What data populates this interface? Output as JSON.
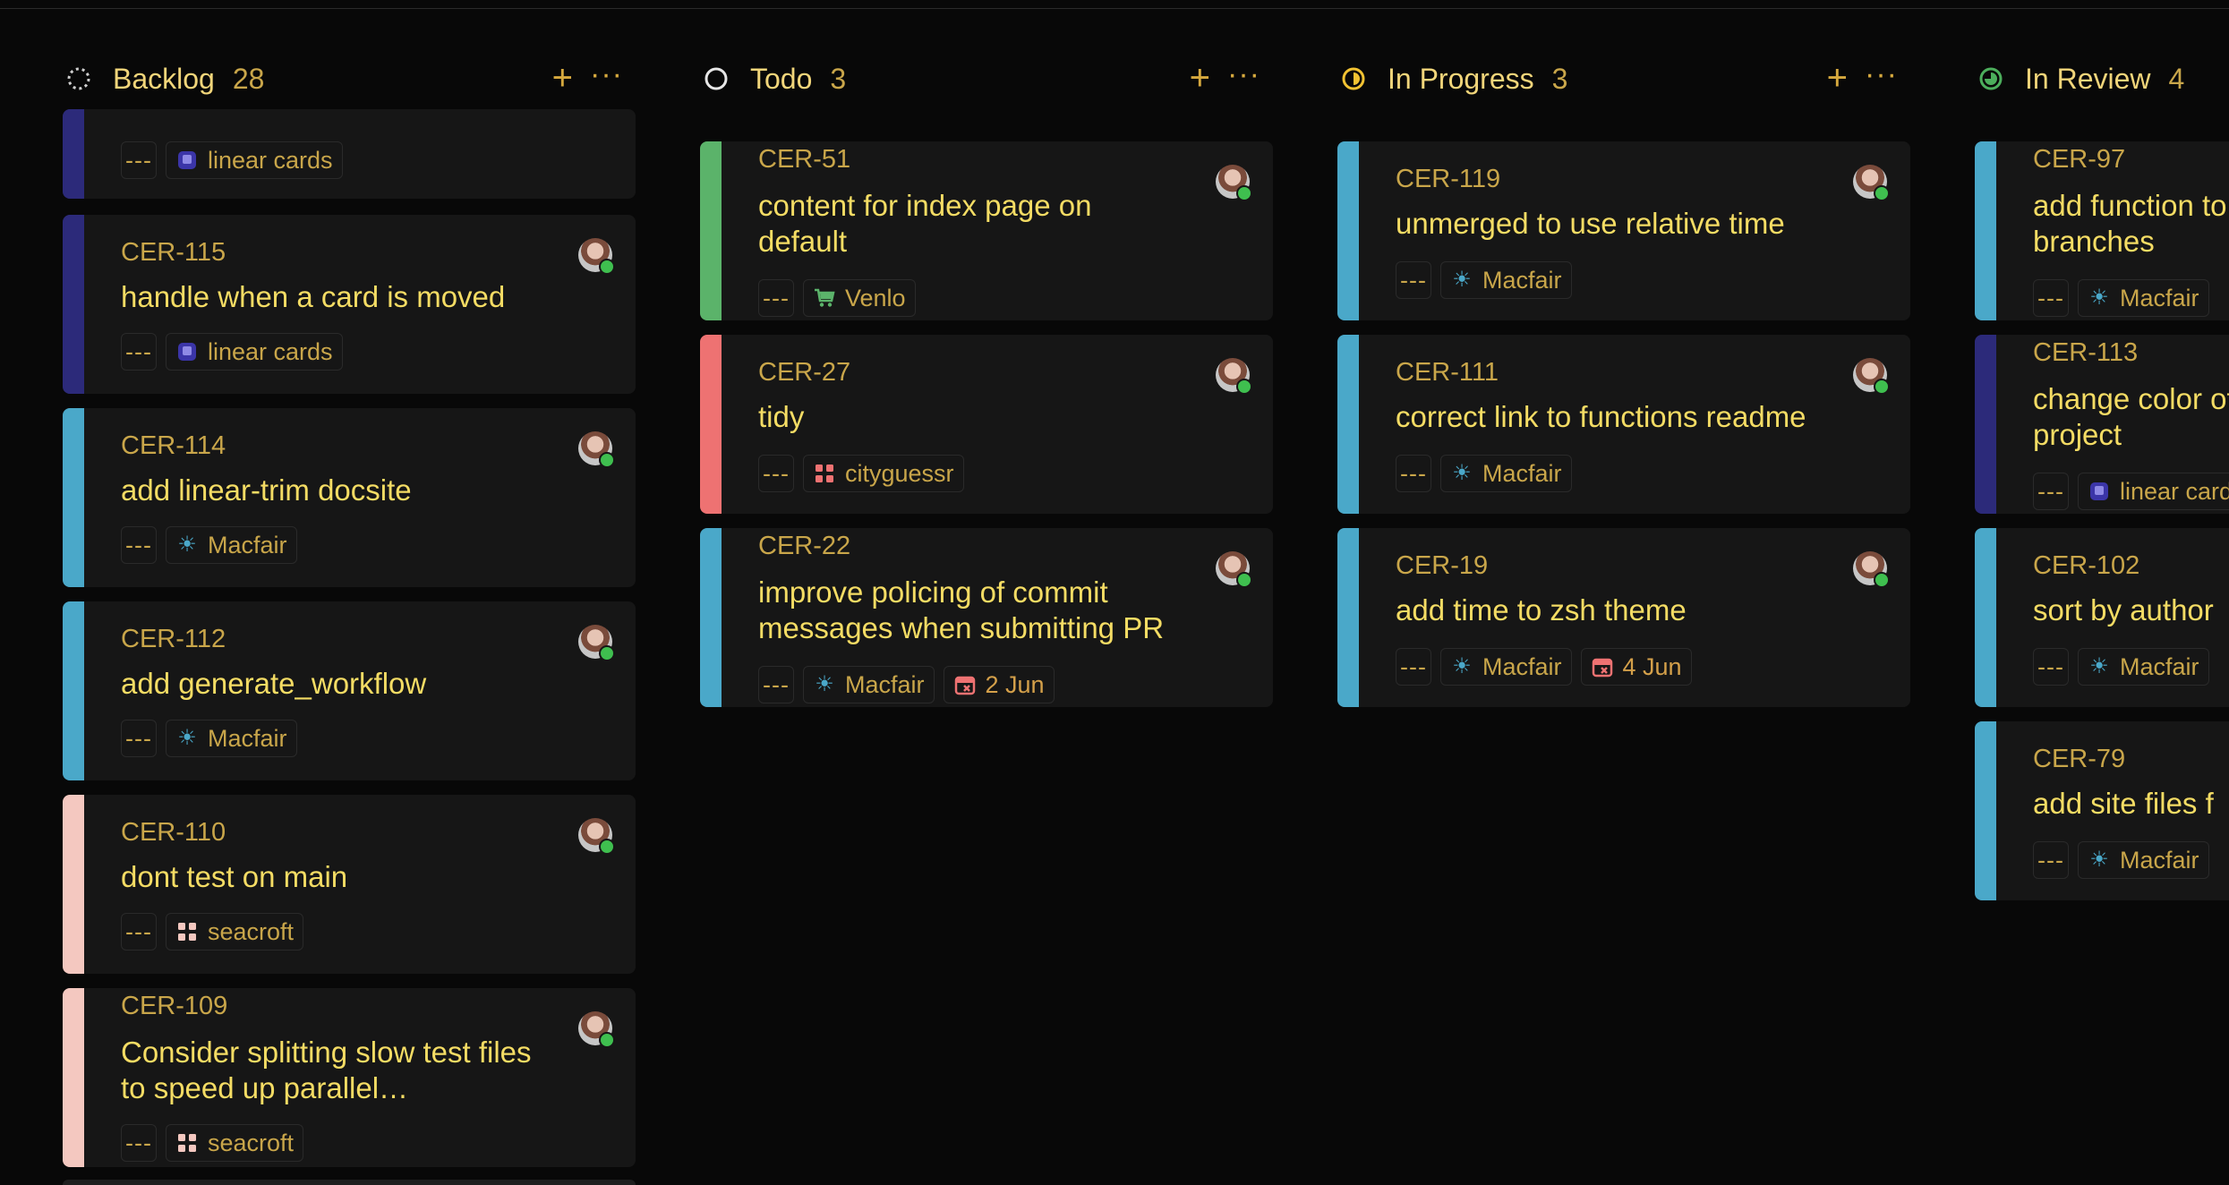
{
  "columns": [
    {
      "title": "Backlog",
      "count": "28",
      "status_icon": "backlog-icon",
      "add_label": "+",
      "more_label": "···",
      "cards": [
        {
          "id": "",
          "title": "",
          "bar_color": "#2c2a7a",
          "project": "linear cards",
          "project_icon": "linear-cards-icon",
          "dots": "---"
        },
        {
          "id": "CER-115",
          "title": "handle when a card is moved",
          "bar_color": "#2c2a7a",
          "project": "linear cards",
          "project_icon": "linear-cards-icon",
          "dots": "---"
        },
        {
          "id": "CER-114",
          "title": "add linear-trim docsite",
          "bar_color": "#4aa8c9",
          "project": "Macfair",
          "project_icon": "sun-icon",
          "dots": "---"
        },
        {
          "id": "CER-112",
          "title": "add generate_workflow",
          "bar_color": "#4aa8c9",
          "project": "Macfair",
          "project_icon": "sun-icon",
          "dots": "---"
        },
        {
          "id": "CER-110",
          "title": "dont test on main",
          "bar_color": "#f4c8c0",
          "project": "seacroft",
          "project_icon": "grid-icon",
          "dots": "---"
        },
        {
          "id": "CER-109",
          "title": "Consider splitting slow test files to speed up parallel…",
          "bar_color": "#f4c8c0",
          "project": "seacroft",
          "project_icon": "grid-icon",
          "dots": "---"
        }
      ]
    },
    {
      "title": "Todo",
      "count": "3",
      "status_icon": "todo-icon",
      "add_label": "+",
      "more_label": "···",
      "cards": [
        {
          "id": "CER-51",
          "title": "content for index page on default",
          "bar_color": "#5bb36a",
          "project": "Venlo",
          "project_icon": "cart-icon",
          "dots": "---"
        },
        {
          "id": "CER-27",
          "title": "tidy",
          "bar_color": "#ee7272",
          "project": "cityguessr",
          "project_icon": "grid-icon",
          "dots": "---"
        },
        {
          "id": "CER-22",
          "title": "improve policing of commit messages when submitting PR",
          "bar_color": "#4aa8c9",
          "project": "Macfair",
          "project_icon": "sun-icon",
          "dots": "---",
          "due": "2 Jun"
        }
      ]
    },
    {
      "title": "In Progress",
      "count": "3",
      "status_icon": "in-progress-icon",
      "add_label": "+",
      "more_label": "···",
      "cards": [
        {
          "id": "CER-119",
          "title": "unmerged to use relative time",
          "bar_color": "#4aa8c9",
          "project": "Macfair",
          "project_icon": "sun-icon",
          "dots": "---"
        },
        {
          "id": "CER-111",
          "title": "correct link to functions readme",
          "bar_color": "#4aa8c9",
          "project": "Macfair",
          "project_icon": "sun-icon",
          "dots": "---"
        },
        {
          "id": "CER-19",
          "title": "add time to zsh theme",
          "bar_color": "#4aa8c9",
          "project": "Macfair",
          "project_icon": "sun-icon",
          "dots": "---",
          "due": "4 Jun"
        }
      ]
    },
    {
      "title": "In Review",
      "count": "4",
      "status_icon": "in-review-icon",
      "add_label": "+",
      "more_label": "···",
      "cards": [
        {
          "id": "CER-97",
          "title": "add function to branches",
          "bar_color": "#4aa8c9",
          "project": "Macfair",
          "project_icon": "sun-icon",
          "dots": "---"
        },
        {
          "id": "CER-113",
          "title": "change color of project",
          "bar_color": "#2c2a7a",
          "project": "linear cards",
          "project_icon": "linear-cards-icon",
          "dots": "---"
        },
        {
          "id": "CER-102",
          "title": "sort by author",
          "bar_color": "#4aa8c9",
          "project": "Macfair",
          "project_icon": "sun-icon",
          "dots": "---"
        },
        {
          "id": "CER-79",
          "title": "add site files f",
          "bar_color": "#4aa8c9",
          "project": "Macfair",
          "project_icon": "sun-icon",
          "dots": "---"
        }
      ]
    }
  ],
  "colors": {
    "background": "#080808",
    "card": "#161616",
    "title": "#f4dc64",
    "id": "#c9a64a",
    "due_icon": "#ee7272",
    "online": "#3fbf4f"
  }
}
